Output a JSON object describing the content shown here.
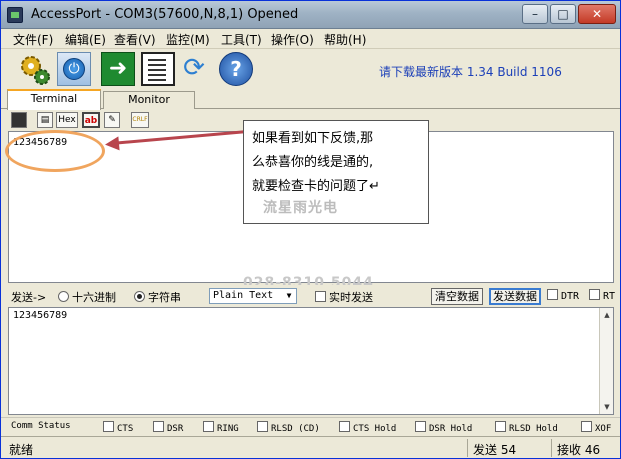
{
  "window": {
    "title": "AccessPort - COM3(57600,N,8,1) Opened"
  },
  "menu": [
    "文件(F)",
    "编辑(E)",
    "查看(V)",
    "监控(M)",
    "工具(T)",
    "操作(O)",
    "帮助(H)"
  ],
  "toolbar": {
    "version_text": "请下载最新版本 1.34 Build 1106",
    "icons": [
      "gear-icon",
      "power-icon",
      "arrow-right-icon",
      "document-icon",
      "refresh-icon",
      "help-icon"
    ]
  },
  "tabs": [
    "Terminal",
    "Monitor"
  ],
  "small_toolbar": {
    "hex_label": "Hex",
    "ab_label": "ab",
    "crlf_label": "CRLF"
  },
  "receive": {
    "text": "123456789"
  },
  "annotation": {
    "lines": [
      "如果看到如下反馈,那",
      "么恭喜你的线是通的,",
      "就要检查卡的问题了↵"
    ],
    "watermark": "流星雨光电",
    "phone_watermark": "028-8310 5044"
  },
  "send": {
    "label": "发送->",
    "radio_hex": "十六进制",
    "radio_string": "字符串",
    "format": "Plain Text",
    "timed_send": "实时发送",
    "clear_button": "清空数据",
    "send_button": "发送数据",
    "dtr": "DTR",
    "rts": "RT",
    "text": "123456789"
  },
  "comm_status": {
    "label": "Comm Status",
    "items": [
      "CTS",
      "DSR",
      "RING",
      "RLSD (CD)",
      "CTS Hold",
      "DSR Hold",
      "RLSD Hold",
      "XOF"
    ]
  },
  "status": {
    "ready": "就绪",
    "sent": "发送 54",
    "received": "接收 46"
  },
  "colors": {
    "accent": "#1b3fb8",
    "annotation_arrow": "#b8454d",
    "highlight_oval": "#f0a55e"
  }
}
